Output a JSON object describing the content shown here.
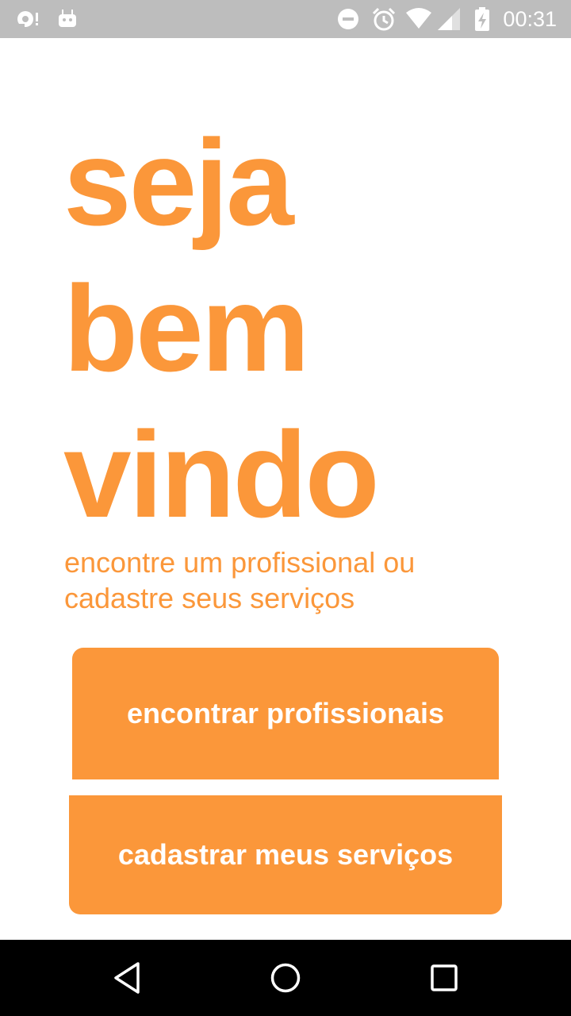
{
  "status_bar": {
    "time": "00:31",
    "left_icons": [
      "notification-icon",
      "android-debug-icon"
    ],
    "right_icons": [
      "do-not-disturb-icon",
      "alarm-icon",
      "wifi-icon",
      "cell-signal-icon",
      "battery-charging-icon"
    ]
  },
  "welcome": {
    "line1": "seja",
    "line2": "bem",
    "line3": "vindo"
  },
  "subtitle": "encontre um profissional ou cadastre seus serviços",
  "buttons": {
    "find": "encontrar profissionais",
    "register": "cadastrar meus serviços"
  },
  "navigation": {
    "icons": [
      "back-icon",
      "home-icon",
      "recents-icon"
    ]
  },
  "colors": {
    "accent": "#fb973a",
    "status_bar": "#bdbdbd",
    "nav_bar": "#000000"
  }
}
